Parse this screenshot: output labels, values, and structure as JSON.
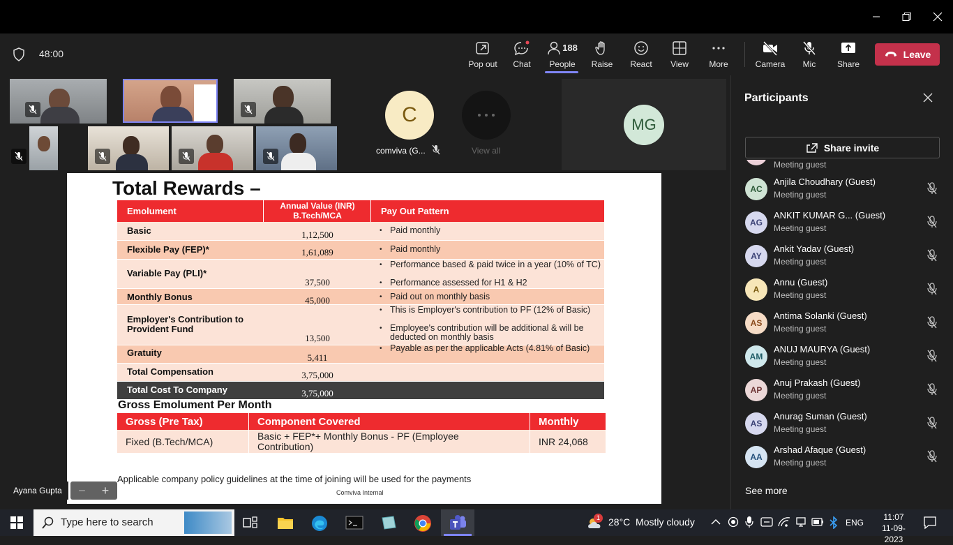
{
  "timer": "48:00",
  "toolbar": {
    "popout": "Pop out",
    "chat": "Chat",
    "people": "People",
    "people_count": "188",
    "raise": "Raise",
    "react": "React",
    "view": "View",
    "more": "More",
    "camera": "Camera",
    "mic": "Mic",
    "share": "Share",
    "leave": "Leave"
  },
  "stage": {
    "c_initial": "C",
    "c_label": "comviva (G...",
    "view_all": "View all",
    "mg_initials": "MG",
    "presenter_name": "Ayana Gupta"
  },
  "participants": {
    "title": "Participants",
    "share_invite": "Share invite",
    "partial_role": "Meeting guest",
    "see_more": "See more",
    "list": [
      {
        "initials": "AC",
        "name": "Anjila Choudhary (Guest)",
        "role": "Meeting guest",
        "bg": "#cfe3d4",
        "fg": "#2e5b3a"
      },
      {
        "initials": "AG",
        "name": "ANKIT KUMAR G... (Guest)",
        "role": "Meeting guest",
        "bg": "#d6d8ee",
        "fg": "#3b4275"
      },
      {
        "initials": "AY",
        "name": "Ankit Yadav (Guest)",
        "role": "Meeting guest",
        "bg": "#d6d8ee",
        "fg": "#3b4275"
      },
      {
        "initials": "A",
        "name": "Annu (Guest)",
        "role": "Meeting guest",
        "bg": "#f7e6b8",
        "fg": "#7a5a10"
      },
      {
        "initials": "AS",
        "name": "Antima Solanki (Guest)",
        "role": "Meeting guest",
        "bg": "#f6dcc6",
        "fg": "#8a4a1c"
      },
      {
        "initials": "AM",
        "name": "ANUJ MAURYA (Guest)",
        "role": "Meeting guest",
        "bg": "#cfe8ec",
        "fg": "#1f5c66"
      },
      {
        "initials": "AP",
        "name": "Anuj Prakash (Guest)",
        "role": "Meeting guest",
        "bg": "#ecd8d8",
        "fg": "#6e3636"
      },
      {
        "initials": "AS",
        "name": "Anurag Suman (Guest)",
        "role": "Meeting guest",
        "bg": "#d6d8ee",
        "fg": "#3b4275"
      },
      {
        "initials": "AA",
        "name": "Arshad Afaque (Guest)",
        "role": "Meeting guest",
        "bg": "#d6e4f2",
        "fg": "#24507a"
      }
    ]
  },
  "slide": {
    "title": "Total Rewards –",
    "headers": [
      "Emolument",
      "Annual Value (INR)",
      "B.Tech/MCA",
      "Pay Out Pattern"
    ],
    "rows": [
      {
        "label": "Basic",
        "value": "1,12,500",
        "notes": [
          "Paid monthly"
        ]
      },
      {
        "label": "Flexible Pay (FEP)*",
        "value": "1,61,089",
        "notes": [
          "Paid monthly"
        ]
      },
      {
        "label": "Variable Pay (PLI)*",
        "value": "37,500",
        "notes": [
          " Performance based & paid twice in a year (10% of TC)",
          " Performance assessed for H1 & H2"
        ]
      },
      {
        "label": "Monthly Bonus",
        "value": "45,000",
        "notes": [
          "Paid out on monthly basis"
        ]
      },
      {
        "label": "Employer's Contribution to Provident Fund",
        "value": "13,500",
        "notes": [
          "This is Employer's contribution to PF (12% of Basic)",
          "Employee's contribution will be additional & will be deducted on monthly basis"
        ]
      },
      {
        "label": "Gratuity",
        "value": "5,411",
        "notes": [
          "Payable as per the applicable Acts (4.81% of Basic)"
        ]
      },
      {
        "label": "Total Compensation",
        "value": "3,75,000",
        "notes": []
      },
      {
        "label": "Total Cost To Company",
        "value": "3,75,000",
        "notes": []
      }
    ],
    "gross_title": "Gross Emolument Per Month",
    "gross_headers": [
      "Gross (Pre Tax)",
      "Component Covered",
      "Monthly"
    ],
    "gross_row": [
      "Fixed  (B.Tech/MCA)",
      "Basic + FEP*+ Monthly Bonus - PF (Employee Contribution)",
      "INR 24,068"
    ],
    "footnote": "Applicable company policy guidelines at the time of joining will be used for the payments",
    "footer": "Comviva Internal"
  },
  "zoom": {
    "minus": "−",
    "plus": "+"
  },
  "taskbar": {
    "search_placeholder": "Type here to search",
    "weather_badge": "1",
    "weather": "28°C  Mostly cloudy",
    "lang": "ENG",
    "time": "11:07",
    "date": "11-09-2023"
  },
  "colors": {
    "accent_red": "#ee2b2f",
    "leave_red": "#c4314b",
    "teams_purple": "#7f85f5"
  }
}
